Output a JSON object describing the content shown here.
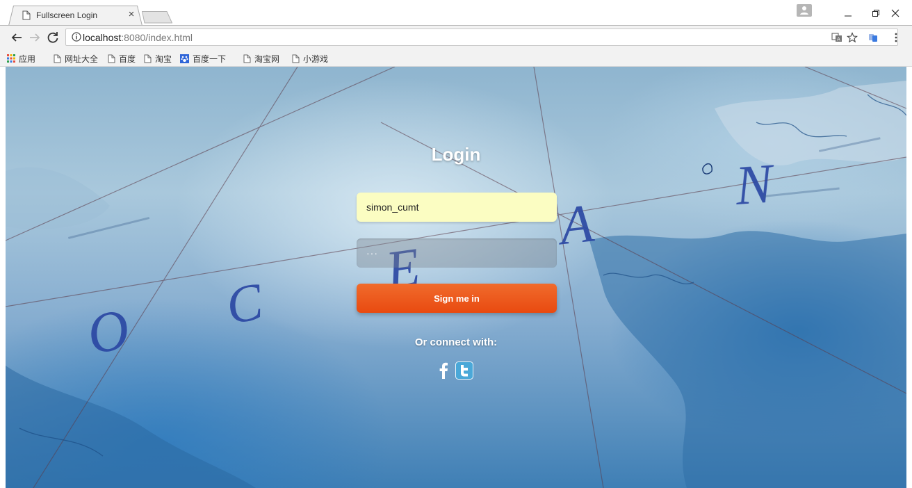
{
  "browser": {
    "tab_title": "Fullscreen Login",
    "tab_close": "×",
    "url_host": "localhost",
    "url_rest": ":8080/index.html"
  },
  "bookmarks": {
    "apps_label": "应用",
    "items": [
      {
        "label": "网址大全",
        "icon": "page-icon"
      },
      {
        "label": "百度",
        "icon": "page-icon"
      },
      {
        "label": "淘宝",
        "icon": "page-icon"
      },
      {
        "label": "百度一下",
        "icon": "baidu-paw-icon"
      },
      {
        "label": "淘宝网",
        "icon": "page-icon"
      },
      {
        "label": "小游戏",
        "icon": "page-icon"
      }
    ]
  },
  "login": {
    "title": "Login",
    "username_value": "simon_cumt",
    "password_display": "···",
    "signin_label": "Sign me in",
    "connect_label": "Or connect with:",
    "social": [
      {
        "name": "facebook",
        "icon": "facebook-icon",
        "glyph": "f"
      },
      {
        "name": "twitter",
        "icon": "twitter-icon",
        "glyph": "t"
      }
    ]
  },
  "map_letters": [
    "O",
    "C",
    "E",
    "A",
    "N"
  ],
  "colors": {
    "signin_button": "#ea5417",
    "username_field_bg": "#fbfdc2",
    "twitter_blue": "#4aa8d8",
    "chrome_bg": "#f2f2f2"
  }
}
